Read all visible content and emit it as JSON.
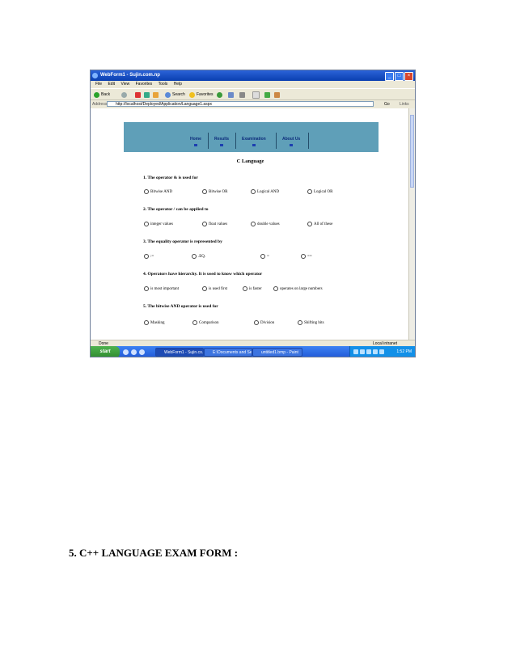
{
  "window": {
    "title": "WebForm1 - Sujin.com.np",
    "menu": [
      "File",
      "Edit",
      "View",
      "Favorites",
      "Tools",
      "Help"
    ],
    "toolbar": {
      "back": "Back",
      "search": "Search",
      "favorites": "Favorites"
    },
    "address_label": "Address",
    "address_value": "http://localhost/Deployed/Application/Language1.aspx",
    "go_label": "Go",
    "links_label": "Links",
    "status_text": "Done",
    "zone_text": "Local intranet"
  },
  "nav": [
    "Home",
    "Results",
    "Examination",
    "About Us"
  ],
  "page_title": "C Language",
  "questions": [
    {
      "text": "1. The operator & is used for",
      "options": [
        "Bitwise AND",
        "Bitwise OR",
        "Logical AND",
        "Logical OR"
      ]
    },
    {
      "text": "2. The operator / can be applied to",
      "options": [
        "integer values",
        "float values",
        "double values",
        "All of these"
      ]
    },
    {
      "text": "3. The equality operator is represented by",
      "options": ":=",
      "options_list": [
        ":=",
        ".EQ.",
        "=",
        "=="
      ]
    },
    {
      "text": "4. Operators have hierarchy. It is used to know which operator",
      "options": [
        "is most important",
        "is used first",
        "is faster",
        "operates on large numbers"
      ]
    },
    {
      "text": "5. The bitwise AND operator is used for",
      "options": [
        "Masking",
        "Comparison",
        "Division",
        "Shifting bits"
      ]
    }
  ],
  "taskbar": {
    "start": "start",
    "tasks": [
      "WebForm1 - Sujin.co...",
      "E:\\Documents and Se...",
      "untitled1.bmp - Paint"
    ],
    "clock": "1:52 PM"
  },
  "caption": "5. C++ LANGUAGE EXAM FORM :"
}
